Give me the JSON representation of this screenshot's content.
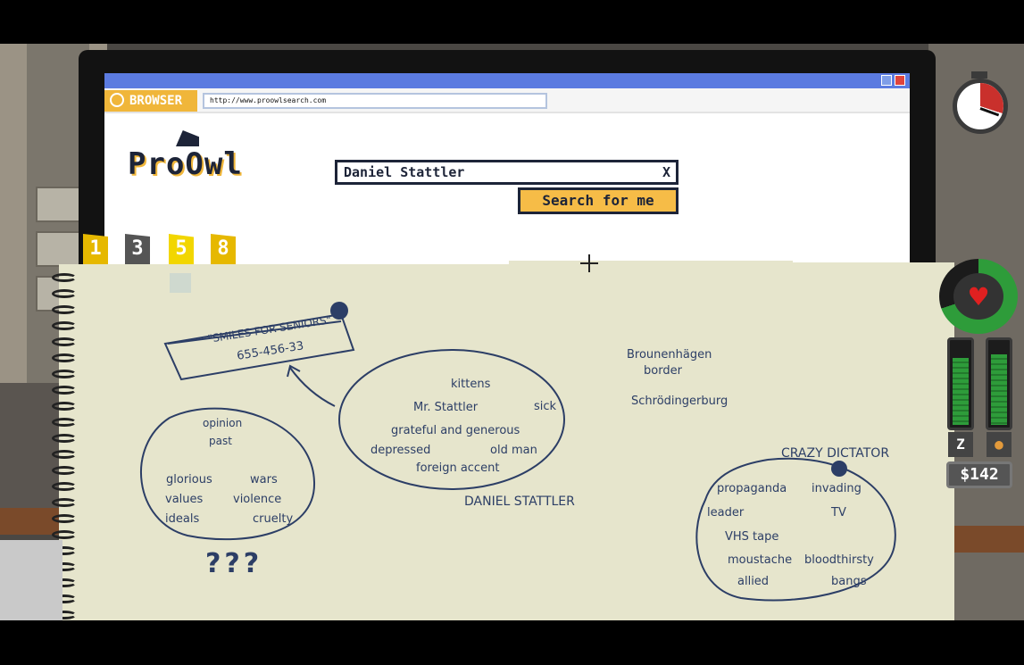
{
  "browser": {
    "tag_label": "BROWSER",
    "url": "http://www.proowlsearch.com",
    "logo_text": "ProOwl",
    "search_value": "Daniel Stattler",
    "clear_glyph": "X",
    "search_button_label": "Search for me"
  },
  "notebook": {
    "tabs": [
      {
        "label": "1",
        "color": "#e6b800"
      },
      {
        "label": "3",
        "color": "#555555"
      },
      {
        "label": "5",
        "color": "#f2d600"
      },
      {
        "label": "8",
        "color": "#e6b800"
      }
    ],
    "active_tab": "5",
    "phone_note": {
      "line1": "\"SMILES FOR SENIORS\"",
      "line2": "655-456-33"
    },
    "center_cluster": {
      "words": [
        "kittens",
        "Mr. Stattler",
        "sick",
        "grateful and generous",
        "depressed",
        "old man",
        "foreign accent"
      ],
      "caption": "DANIEL STATTLER"
    },
    "left_cluster": {
      "words": [
        "opinion",
        "past",
        "glorious",
        "wars",
        "values",
        "violence",
        "ideals",
        "cruelty"
      ],
      "caption": "???"
    },
    "places": [
      "Brounenhägen",
      "border",
      "Schrödingerburg"
    ],
    "right_cluster": {
      "caption": "CRAZY DICTATOR",
      "words": [
        "propaganda",
        "invading",
        "leader",
        "TV",
        "VHS tape",
        "moustache",
        "bloodthirsty",
        "allied",
        "bangs"
      ]
    }
  },
  "hud": {
    "money": "$142",
    "sleep_icon": "Z",
    "health_fraction": 0.7,
    "sleep_level": 0.82,
    "food_level": 0.86,
    "clock_elapsed_fraction": 0.3
  },
  "icons": {
    "browser": "owl-icon",
    "phone": "phone-icon",
    "heart": "heart-icon",
    "sleep": "sleep-icon",
    "food": "drumstick-icon",
    "clock": "stopwatch-icon"
  }
}
